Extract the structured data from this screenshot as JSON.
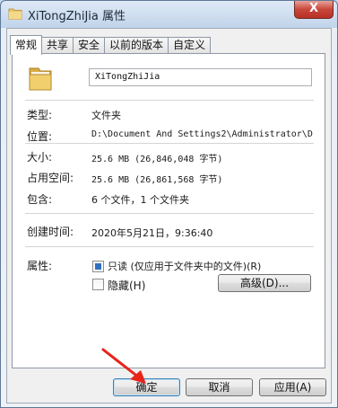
{
  "window": {
    "title": "XiTongZhiJia 属性",
    "close_label": "X"
  },
  "tabs": [
    {
      "label": "常规"
    },
    {
      "label": "共享"
    },
    {
      "label": "安全"
    },
    {
      "label": "以前的版本"
    },
    {
      "label": "自定义"
    }
  ],
  "general": {
    "folder_name": "XiTongZhiJia",
    "type_label": "类型:",
    "type_value": "文件夹",
    "location_label": "位置:",
    "location_value": "D:\\Document And Settings2\\Administrator\\D",
    "size_label": "大小:",
    "size_value": "25.6 MB (26,846,048 字节)",
    "size_on_disk_label": "占用空间:",
    "size_on_disk_value": "25.6 MB (26,861,568 字节)",
    "contains_label": "包含:",
    "contains_value": "6 个文件，1 个文件夹",
    "created_label": "创建时间:",
    "created_value": "2020年5月21日，9:36:40",
    "attributes_label": "属性:",
    "readonly_label": "只读 (仅应用于文件夹中的文件)(R)",
    "readonly_checked": true,
    "hidden_label": "隐藏(H)",
    "hidden_checked": false,
    "advanced_button": "高级(D)..."
  },
  "footer": {
    "ok": "确定",
    "cancel": "取消",
    "apply": "应用(A)"
  },
  "icons": [
    "folder-icon",
    "title-folder-icon",
    "close-icon",
    "red-arrow-annotation"
  ],
  "colors": {
    "accent_checkbox": "#2e6fc2",
    "folder": "#e8c668",
    "annotation_arrow": "#e8231a",
    "close_button": "#c8463a"
  }
}
